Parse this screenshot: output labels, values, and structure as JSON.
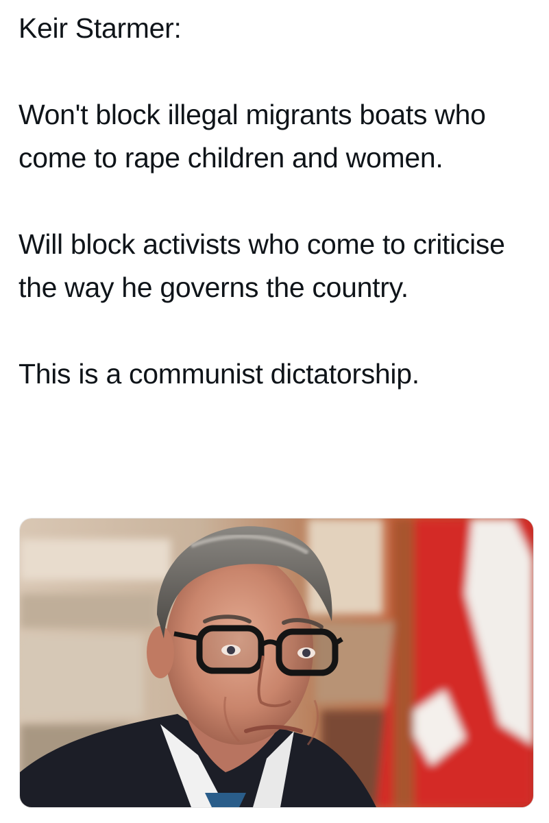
{
  "tweet": {
    "author_line": "Keir Starmer:",
    "paragraph_1": "Won't block illegal migrants boats who come to rape children and women.",
    "paragraph_2": "Will block activists who come to criticise the way he governs the country.",
    "paragraph_3": "This is a communist dictatorship."
  },
  "media": {
    "description": "photo-of-man-with-glasses-in-front-of-union-flag"
  },
  "colors": {
    "text": "#0f1419",
    "background": "#ffffff",
    "flag_red": "#d42a28"
  }
}
